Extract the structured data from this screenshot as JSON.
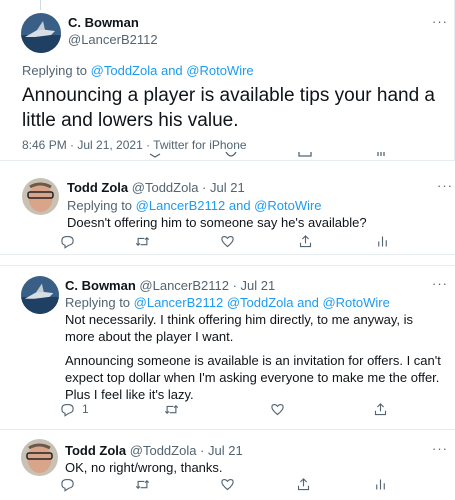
{
  "tweet1": {
    "author_name": "C. Bowman",
    "author_handle": "@LancerB2112",
    "replying_prefix": "Replying to",
    "replying_users": "@ToddZola and @RotoWire",
    "text": "Announcing a player is available tips your hand a little and lowers his value.",
    "meta": "8:46 PM · Jul 21, 2021 · Twitter for iPhone"
  },
  "tweet2": {
    "author_name": "Todd Zola",
    "author_meta": "@ToddZola · Jul 21",
    "replying_prefix": "Replying to",
    "replying_users": "@LancerB2112 and @RotoWire",
    "text": "Doesn't offering him to someone say he's available?"
  },
  "tweet3": {
    "author_name": "C. Bowman",
    "author_meta": "@LancerB2112 · Jul 21",
    "replying_prefix": "Replying to",
    "replying_users": "@LancerB2112 @ToddZola and @RotoWire",
    "text_p1": "Not necessarily. I think offering him directly, to me anyway, is more about the player I want.",
    "text_p2": "Announcing someone is available is an invitation for offers. I can't expect top dollar when I'm asking everyone to make me the offer. Plus I feel like it's lazy.",
    "reply_count": "1"
  },
  "tweet4": {
    "author_name": "Todd Zola",
    "author_meta": "@ToddZola · Jul 21",
    "text": "OK, no right/wrong, thanks."
  },
  "more_label": "···",
  "icons": [
    "reply-icon",
    "retweet-icon",
    "like-icon",
    "share-icon",
    "analytics-icon",
    "more-icon"
  ],
  "colors": {
    "accent": "#1d9bf0",
    "secondary_text": "#536471",
    "text": "#0f1419"
  }
}
